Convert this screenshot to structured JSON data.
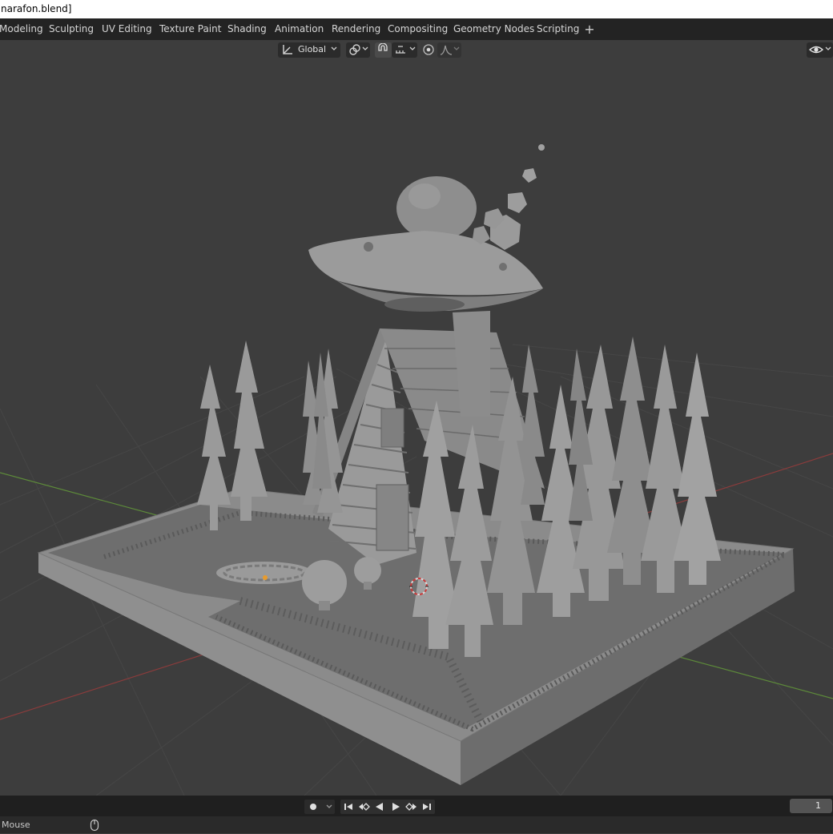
{
  "window": {
    "title": "narafon.blend]"
  },
  "workspaces": {
    "tabs": [
      {
        "label": "Modeling"
      },
      {
        "label": "Sculpting"
      },
      {
        "label": "UV Editing"
      },
      {
        "label": "Texture Paint"
      },
      {
        "label": "Shading"
      },
      {
        "label": "Animation"
      },
      {
        "label": "Rendering"
      },
      {
        "label": "Compositing"
      },
      {
        "label": "Geometry Nodes"
      },
      {
        "label": "Scripting"
      }
    ],
    "add_label": "+"
  },
  "viewport_header": {
    "transform_orientation": "Global",
    "transform_orientation_icon": "transform-orientation-icon",
    "pivot_icon": "pivot-point-icon",
    "snap_icon": "snap-magnet-icon",
    "snap_target_icon": "snap-increment-icon",
    "proportional_icon": "proportional-editing-icon",
    "falloff_icon": "falloff-curve-icon",
    "visibility_icon": "eye-visibility-icon"
  },
  "viewport": {
    "background_color": "#3d3d3d",
    "grid_color": "#474747",
    "x_axis_color": "#8a3c3c",
    "y_axis_color": "#5d8a3a",
    "model_color": "#8e8e8e"
  },
  "timeline": {
    "current_frame": "1",
    "record_icon": "record-keyframe-icon",
    "playback_icons": [
      "jump-start-icon",
      "prev-keyframe-icon",
      "play-reverse-icon",
      "play-icon",
      "next-keyframe-icon",
      "jump-end-icon"
    ]
  },
  "statusbar": {
    "text": "Mouse",
    "mouse_icon": "mouse-icon"
  }
}
